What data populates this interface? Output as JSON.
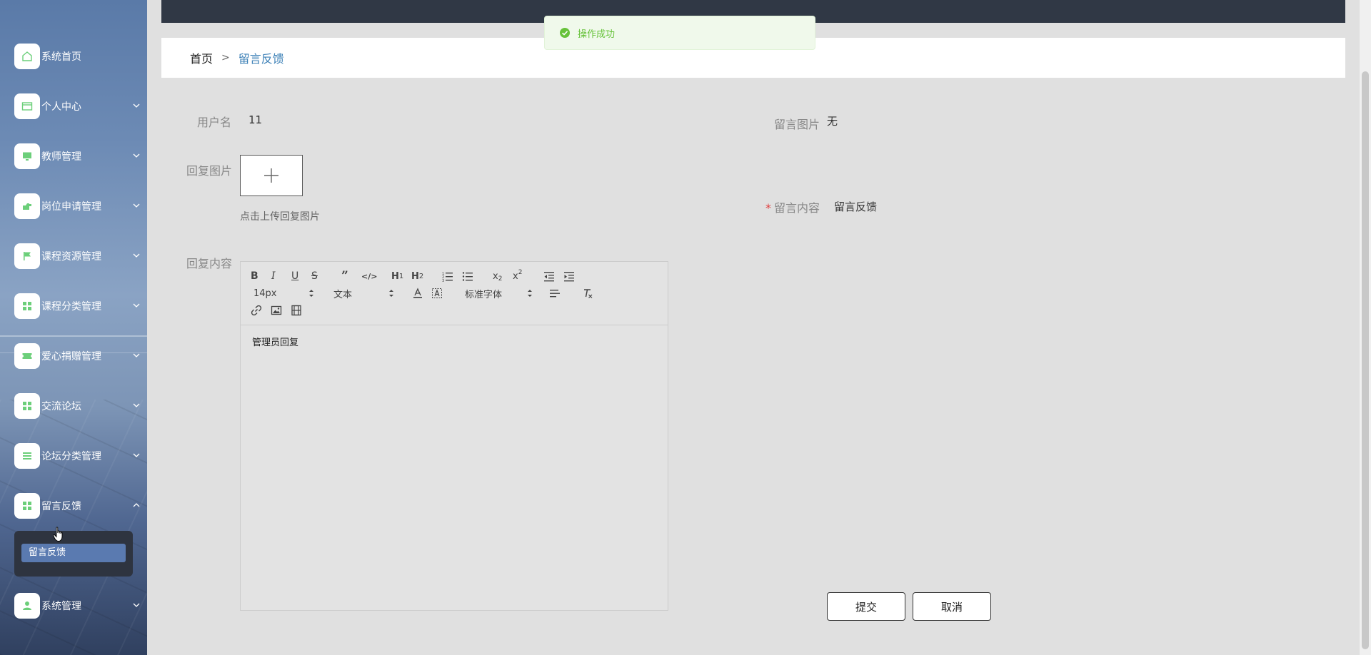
{
  "sidebar": {
    "items": [
      {
        "label": "系统首页",
        "icon": "home-icon",
        "has_chevron": false
      },
      {
        "label": "个人中心",
        "icon": "card-icon",
        "has_chevron": true
      },
      {
        "label": "教师管理",
        "icon": "monitor-icon",
        "has_chevron": true
      },
      {
        "label": "岗位申请管理",
        "icon": "hand-icon",
        "has_chevron": true
      },
      {
        "label": "课程资源管理",
        "icon": "flag-icon",
        "has_chevron": true
      },
      {
        "label": "课程分类管理",
        "icon": "grid-icon",
        "has_chevron": true
      },
      {
        "label": "爱心捐赠管理",
        "icon": "ticket-icon",
        "has_chevron": true
      },
      {
        "label": "交流论坛",
        "icon": "grid-icon",
        "has_chevron": true
      },
      {
        "label": "论坛分类管理",
        "icon": "list-icon",
        "has_chevron": true
      },
      {
        "label": "留言反馈",
        "icon": "grid-icon",
        "has_chevron": true,
        "expanded": true
      },
      {
        "label": "系统管理",
        "icon": "user-icon",
        "has_chevron": true
      }
    ],
    "submenu": {
      "label": "留言反馈"
    }
  },
  "toast": {
    "text": "操作成功"
  },
  "breadcrumb": {
    "home": "首页",
    "separator": ">",
    "current": "留言反馈"
  },
  "form": {
    "username_label": "用户名",
    "username_value": "11",
    "reply_image_label": "回复图片",
    "upload_tip": "点击上传回复图片",
    "reply_content_label": "回复内容",
    "message_image_label": "留言图片",
    "message_image_value": "无",
    "message_content_label": "留言内容",
    "message_content_value": "留言反馈"
  },
  "editor": {
    "font_size": "14px",
    "header": "文本",
    "font_family": "标准字体",
    "content": "管理员回复"
  },
  "buttons": {
    "submit": "提交",
    "cancel": "取消"
  },
  "colors": {
    "accent": "#3a7fb6",
    "success": "#67c23a",
    "topbar": "#303845"
  }
}
